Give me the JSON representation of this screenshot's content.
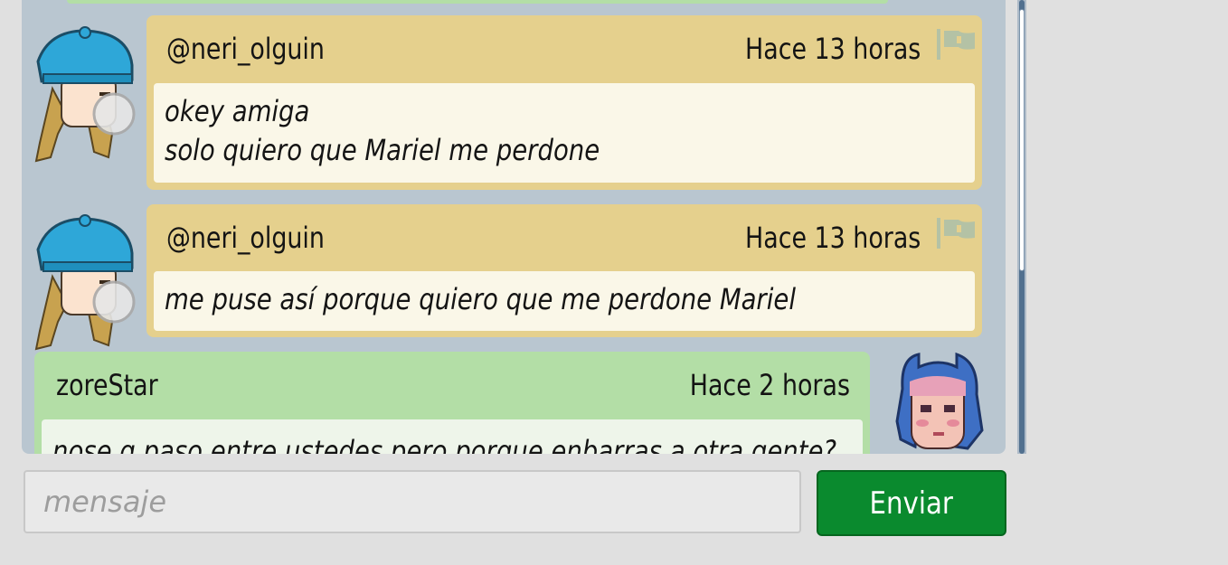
{
  "colors": {
    "panel_bg": "#b9c6d0",
    "other_bubble": "#e5d08d",
    "self_bubble": "#b3dea6",
    "send_button": "#0a8a2e"
  },
  "messages": [
    {
      "author": "@neri_olguin",
      "time": "Hace 13 horas",
      "lines": [
        "okey amiga",
        "solo quiero que Mariel me perdone"
      ],
      "avatar_icon": "habbo-avatar-blue-cap-icon",
      "flag_icon": "report-flag-icon"
    },
    {
      "author": "@neri_olguin",
      "time": "Hace 13 horas",
      "lines": [
        "me puse así porque quiero que me perdone Mariel"
      ],
      "avatar_icon": "habbo-avatar-blue-cap-icon",
      "flag_icon": "report-flag-icon"
    },
    {
      "author": "zoreStar",
      "time": "Hace 2 horas",
      "lines": [
        "nose q paso entre ustedes pero porque enbarras a otra gente?"
      ],
      "avatar_icon": "habbo-avatar-blue-hair-icon"
    }
  ],
  "composer": {
    "placeholder": "mensaje",
    "value": "",
    "send_label": "Enviar"
  }
}
